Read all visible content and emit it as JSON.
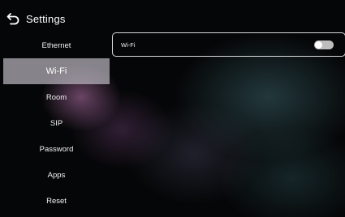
{
  "header": {
    "title": "Settings",
    "back_icon": "back-arrow-icon"
  },
  "menu": {
    "items": [
      {
        "label": "Ethernet",
        "selected": false
      },
      {
        "label": "Wi-Fi",
        "selected": true
      },
      {
        "label": "Room",
        "selected": false
      },
      {
        "label": "SIP",
        "selected": false
      },
      {
        "label": "Password",
        "selected": false
      },
      {
        "label": "Apps",
        "selected": false
      },
      {
        "label": "Reset",
        "selected": false
      }
    ]
  },
  "wifi": {
    "label": "Wi-Fi",
    "toggle_on": false
  },
  "colors": {
    "background": "#050607",
    "selected_item": "#b9b4be",
    "toggle_off": "#bdbdbd"
  }
}
